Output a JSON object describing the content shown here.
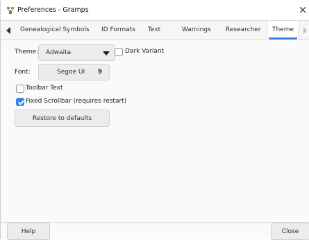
{
  "window": {
    "title": "Preferences - Gramps",
    "close_glyph": "×"
  },
  "tabs": [
    {
      "label": "Genealogical Symbols"
    },
    {
      "label": "ID Formats"
    },
    {
      "label": "Text"
    },
    {
      "label": "Warnings"
    },
    {
      "label": "Researcher"
    },
    {
      "label": "Theme",
      "active": true
    }
  ],
  "theme": {
    "theme_label": "Theme:",
    "theme_value": "Adwaita",
    "dark_variant_label": "Dark Variant",
    "dark_variant_checked": false,
    "font_label": "Font:",
    "font_name": "Segoe UI",
    "font_size": "9",
    "toolbar_text_label": "Toolbar Text",
    "toolbar_text_checked": false,
    "fixed_scrollbar_label": "Fixed Scrollbar (requires restart)",
    "fixed_scrollbar_checked": true,
    "restore_label": "Restore to defaults"
  },
  "footer": {
    "help_label": "Help",
    "close_label": "Close"
  },
  "colors": {
    "accent": "#3584e4"
  },
  "icons": [
    "app-icon",
    "close-icon",
    "scroll-left-icon",
    "scroll-right-icon",
    "dropdown-arrow-icon",
    "checkmark-icon"
  ]
}
